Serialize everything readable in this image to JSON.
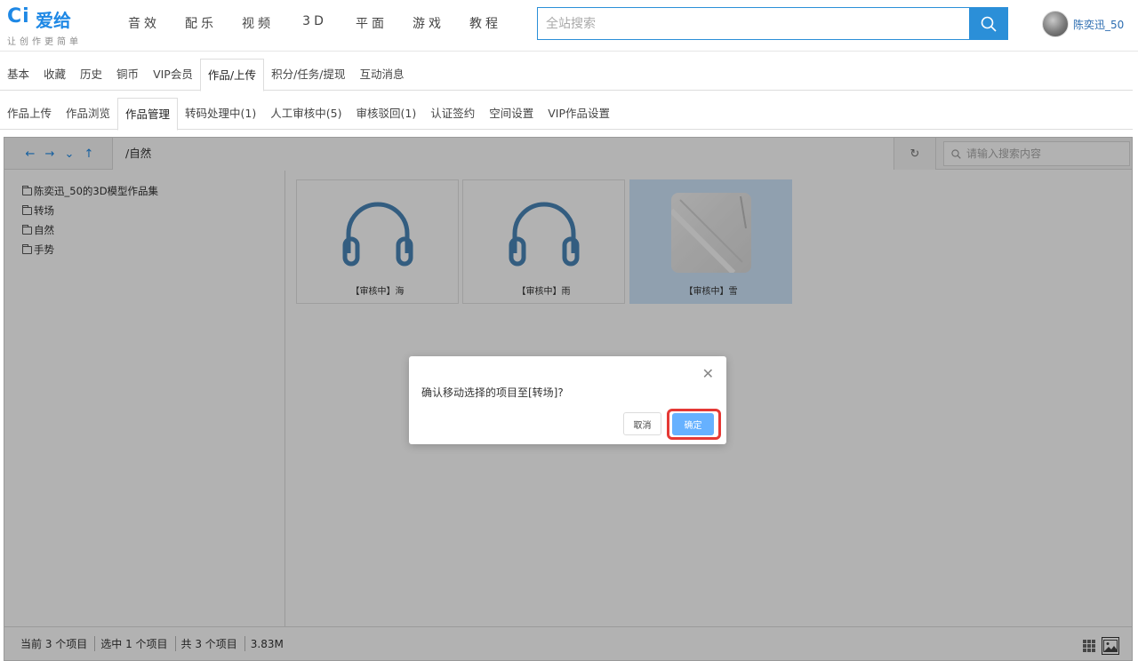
{
  "header": {
    "logo_mark": "Ci",
    "logo_name": "爱给",
    "slogan": "让创作更简单",
    "nav": [
      "音效",
      "配乐",
      "视频",
      "3D",
      "平面",
      "游戏",
      "教程"
    ],
    "search_placeholder": "全站搜索",
    "username": "陈奕迅_50",
    "accent": "#2b8fd8"
  },
  "tabs_primary": [
    "基本",
    "收藏",
    "历史",
    "铜币",
    "VIP会员",
    "作品/上传",
    "积分/任务/提现",
    "互动消息"
  ],
  "tabs_primary_active": "作品/上传",
  "tabs_secondary": [
    "作品上传",
    "作品浏览",
    "作品管理",
    "转码处理中(1)",
    "人工审核中(5)",
    "审核驳回(1)",
    "认证签约",
    "空间设置",
    "VIP作品设置"
  ],
  "tabs_secondary_active": "作品管理",
  "file_manager": {
    "path": "/自然",
    "search_placeholder": "请输入搜索内容",
    "tree": [
      "陈奕迅_50的3D模型作品集",
      "转场",
      "自然",
      "手势"
    ],
    "items": [
      {
        "label": "【审核中】海",
        "icon": "headphones-icon",
        "selected": false
      },
      {
        "label": "【审核中】雨",
        "icon": "headphones-icon",
        "selected": false
      },
      {
        "label": "【审核中】雪",
        "icon": "photo-thumbnail",
        "selected": true
      }
    ],
    "status": {
      "current": "当前 3 个项目",
      "selected": "选中 1 个项目",
      "total": "共 3 个项目",
      "size": "3.83M"
    }
  },
  "dialog": {
    "message": "确认移动选择的项目至[转场]?",
    "cancel_label": "取消",
    "ok_label": "确定",
    "ok_color": "#66b1ff",
    "highlight_color": "#e53935"
  }
}
